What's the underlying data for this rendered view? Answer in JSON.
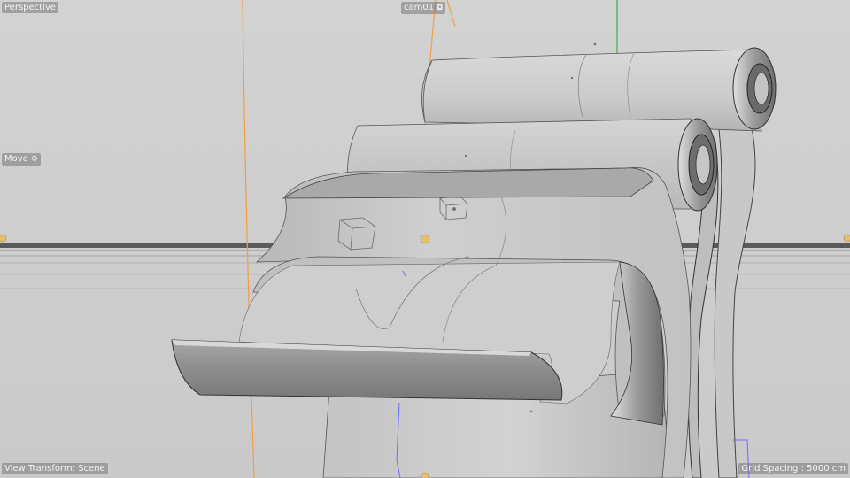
{
  "viewport": {
    "view_name": "Perspective",
    "camera_name": "cam01",
    "camera_icon": "camera-icon",
    "tool_name": "Move",
    "tool_icon": "gear-icon",
    "view_transform_label": "View Transform: Scene",
    "grid_spacing_label": "Grid Spacing : 5000 cm"
  },
  "colors": {
    "background": "#cdcdcd",
    "surface_light": "#d8d8d8",
    "surface_dark": "#6c6c6c",
    "y_axis": "#3fae3f",
    "orange_guide": "#f0a040",
    "blue_guide": "#6b6bff",
    "light_marker": "#e6c070",
    "hud_bg": "#8a8a8a"
  }
}
